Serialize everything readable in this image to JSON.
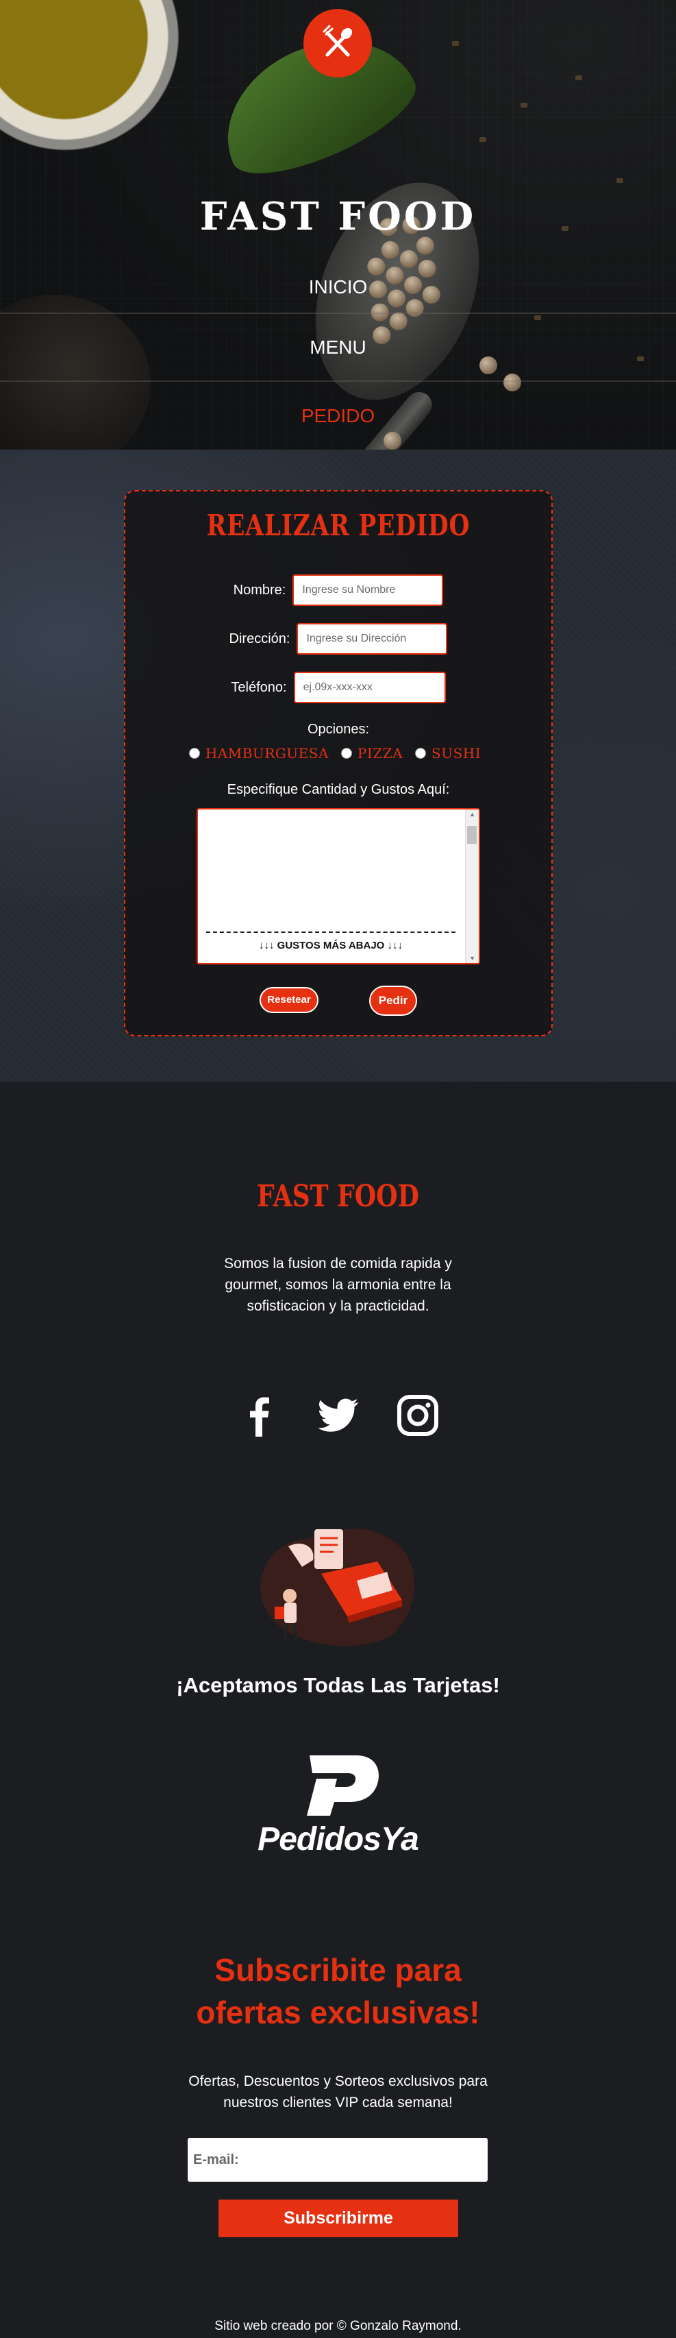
{
  "header": {
    "title": "FAST FOOD",
    "nav": [
      {
        "label": "INICIO"
      },
      {
        "label": "MENU"
      },
      {
        "label": "PEDIDO"
      }
    ]
  },
  "order_form": {
    "title": "REALIZAR PEDIDO",
    "name_label": "Nombre:",
    "name_placeholder": "Ingrese su Nombre",
    "address_label": "Dirección:",
    "address_placeholder": "Ingrese su Dirección",
    "phone_label": "Teléfono:",
    "phone_placeholder": "ej.09x-xxx-xxx",
    "options_title": "Opciones:",
    "options": [
      "HAMBURGUESA",
      "PIZZA",
      "SUSHI"
    ],
    "specify_label": "Especifique Cantidad y Gustos Aquí:",
    "textarea_hint": "↓↓↓ GUSTOS MÁS ABAJO ↓↓↓",
    "reset_label": "Resetear",
    "submit_label": "Pedir"
  },
  "footer": {
    "brand": "FAST FOOD",
    "about_line1": "Somos la fusion de comida rapida y",
    "about_line2": "gourmet, somos la armonia entre la",
    "about_line3": "sofisticacion y la practicidad.",
    "socials": [
      "facebook-icon",
      "twitter-icon",
      "instagram-icon"
    ],
    "cards_text": "¡Aceptamos Todas Las Tarjetas!",
    "partner_name": "PedidosYa",
    "subscribe_title_line1": "Subscribite para",
    "subscribe_title_line2": "ofertas exclusivas!",
    "subscribe_text_line1": "Ofertas, Descuentos y Sorteos exclusivos para",
    "subscribe_text_line2": "nuestros clientes VIP cada semana!",
    "email_placeholder": "E-mail:",
    "subscribe_button": "Subscribirme",
    "credit": "Sitio web creado por © Gonzalo Raymond."
  },
  "colors": {
    "accent": "#e53012",
    "background": "#1b1d20"
  }
}
